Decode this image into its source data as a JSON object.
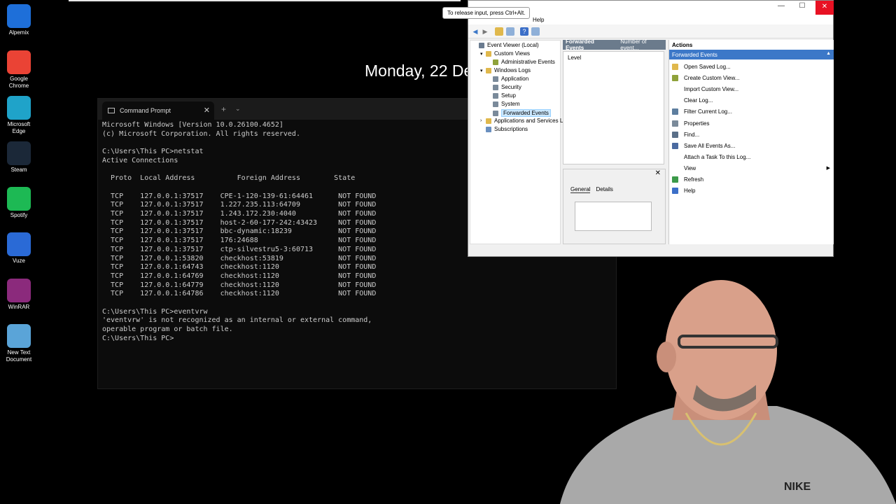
{
  "desktop": {
    "icons": [
      {
        "label": "Alpemix",
        "color": "#1e6fd9"
      },
      {
        "label": "Google Chrome",
        "color": "#ea4335"
      },
      {
        "label": "Microsoft Edge",
        "color": "#1fa3c9"
      },
      {
        "label": "Steam",
        "color": "#1b2838"
      },
      {
        "label": "Spotify",
        "color": "#1db954"
      },
      {
        "label": "Vuze",
        "color": "#2a6ad6"
      },
      {
        "label": "WinRAR",
        "color": "#8b2a7c"
      },
      {
        "label": "New Text Document",
        "color": "#5aa4d8"
      }
    ],
    "clock_date": "Monday, 22 De"
  },
  "tooltip": "To release input, press Ctrl+Alt.",
  "cmd": {
    "tab_title": "Command Prompt",
    "output": "Microsoft Windows [Version 10.0.26100.4652]\n(c) Microsoft Corporation. All rights reserved.\n\nC:\\Users\\This PC>netstat\nActive Connections\n\n  Proto  Local Address          Foreign Address        State\n\n  TCP    127.0.0.1:37517    CPE-1-120-139-61:64461      NOT FOUND\n  TCP    127.0.0.1:37517    1.227.235.113:64709         NOT FOUND\n  TCP    127.0.0.1:37517    1.243.172.230:4040          NOT FOUND\n  TCP    127.0.0.1:37517    host-2-60-177-242:43423     NOT FOUND\n  TCP    127.0.0.1:37517    bbc-dynamic:18239           NOT FOUND\n  TCP    127.0.0.1:37517    176:24688                   NOT FOUND\n  TCP    127.0.0.1:37517    ctp-silvestru5-3:60713      NOT FOUND\n  TCP    127.0.0.1:53820    checkhost:53819             NOT FOUND\n  TCP    127.0.0.1:64743    checkhost:1120              NOT FOUND\n  TCP    127.0.0.1:64769    checkhost:1120              NOT FOUND\n  TCP    127.0.0.1:64779    checkhost:1120              NOT FOUND\n  TCP    127.0.0.1:64786    checkhost:1120              NOT FOUND\n\nC:\\Users\\This PC>eventvrw\n'eventvrw' is not recognized as an internal or external command,\noperable program or batch file.\nC:\\Users\\This PC>"
  },
  "eventviewer": {
    "menu_help": "Help",
    "tree": [
      {
        "label": "Event Viewer (Local)",
        "indent": 0,
        "expander": "",
        "color": "#6a7b8f"
      },
      {
        "label": "Custom Views",
        "indent": 1,
        "expander": "▾",
        "color": "#e0b84c"
      },
      {
        "label": "Administrative Events",
        "indent": 2,
        "expander": "",
        "color": "#8fa23a"
      },
      {
        "label": "Windows Logs",
        "indent": 1,
        "expander": "▾",
        "color": "#e0b84c"
      },
      {
        "label": "Application",
        "indent": 2,
        "expander": "",
        "color": "#7a8a9a"
      },
      {
        "label": "Security",
        "indent": 2,
        "expander": "",
        "color": "#7a8a9a"
      },
      {
        "label": "Setup",
        "indent": 2,
        "expander": "",
        "color": "#7a8a9a"
      },
      {
        "label": "System",
        "indent": 2,
        "expander": "",
        "color": "#7a8a9a"
      },
      {
        "label": "Forwarded Events",
        "indent": 2,
        "expander": "",
        "color": "#7a8a9a",
        "selected": true
      },
      {
        "label": "Applications and Services Lo",
        "indent": 1,
        "expander": "›",
        "color": "#e0b84c"
      },
      {
        "label": "Subscriptions",
        "indent": 1,
        "expander": "",
        "color": "#6a8fbf"
      }
    ],
    "center": {
      "header_title": "Forwarded Events",
      "header_count": "Number of event...",
      "column_level": "Level",
      "tab_general": "General",
      "tab_details": "Details"
    },
    "actions": {
      "header": "Actions",
      "section": "Forwarded Events",
      "items": [
        {
          "label": "Open Saved Log...",
          "color": "#e0b84c"
        },
        {
          "label": "Create Custom View...",
          "color": "#8fa23a"
        },
        {
          "label": "Import Custom View...",
          "color": "#ffffff"
        },
        {
          "label": "Clear Log...",
          "color": "#ffffff"
        },
        {
          "label": "Filter Current Log...",
          "color": "#5d7e9f"
        },
        {
          "label": "Properties",
          "color": "#7a8a9a"
        },
        {
          "label": "Find...",
          "color": "#5a6f88"
        },
        {
          "label": "Save All Events As...",
          "color": "#4a6aa0"
        },
        {
          "label": "Attach a Task To this Log...",
          "color": "#ffffff"
        },
        {
          "label": "View",
          "color": "#ffffff",
          "submenu": true
        },
        {
          "label": "Refresh",
          "color": "#3c9a4a"
        },
        {
          "label": "Help",
          "color": "#3c6fc8"
        }
      ]
    }
  }
}
